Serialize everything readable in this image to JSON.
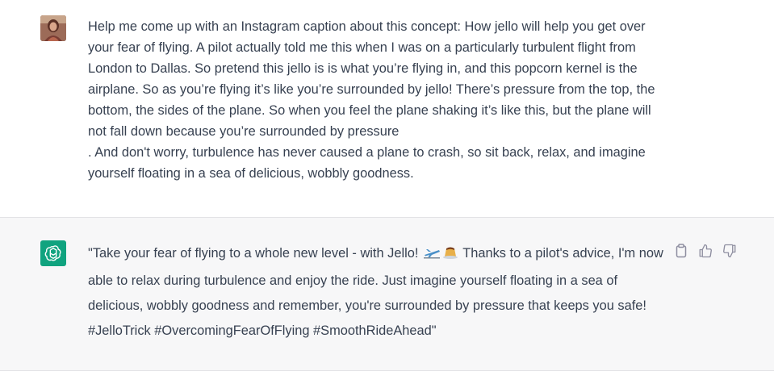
{
  "conversation": {
    "user_message": {
      "avatar": "user-photo-avatar",
      "text": "Help me come up with an Instagram caption about this concept:  How jello will help you get over your fear of flying. A pilot actually told me this when I was on a particularly turbulent flight from London to Dallas. So pretend this jello is is what you’re flying in, and this popcorn kernel is the airplane. So as you’re flying it’s like you’re surrounded by jello! There’s pressure from the top, the bottom, the sides of the plane. So when you feel the plane shaking it’s like this, but the plane will not fall down because you’re surrounded by pressure\n. And don't worry, turbulence has never caused a plane to crash, so sit back, relax, and imagine yourself floating in a sea of delicious, wobbly goodness."
    },
    "assistant_message": {
      "avatar": "openai-logo-icon",
      "text_before_emoji": "\"Take your fear of flying to a whole new level - with Jello! ",
      "emojis": [
        "airplane-emoji",
        "pudding-emoji"
      ],
      "text_after_emoji": " Thanks to a pilot's advice, I'm now able to relax during turbulence and enjoy the ride. Just imagine yourself floating in a sea of delicious, wobbly goodness and remember, you're surrounded by pressure that keeps you safe! #JelloTrick #OvercomingFearOfFlying #SmoothRideAhead\"",
      "actions": [
        "copy-icon",
        "thumbs-up-icon",
        "thumbs-down-icon"
      ]
    }
  },
  "colors": {
    "assistant_bg": "#f7f7f8",
    "brand": "#10a37f",
    "text": "#374151",
    "icon": "#8e8ea0"
  }
}
